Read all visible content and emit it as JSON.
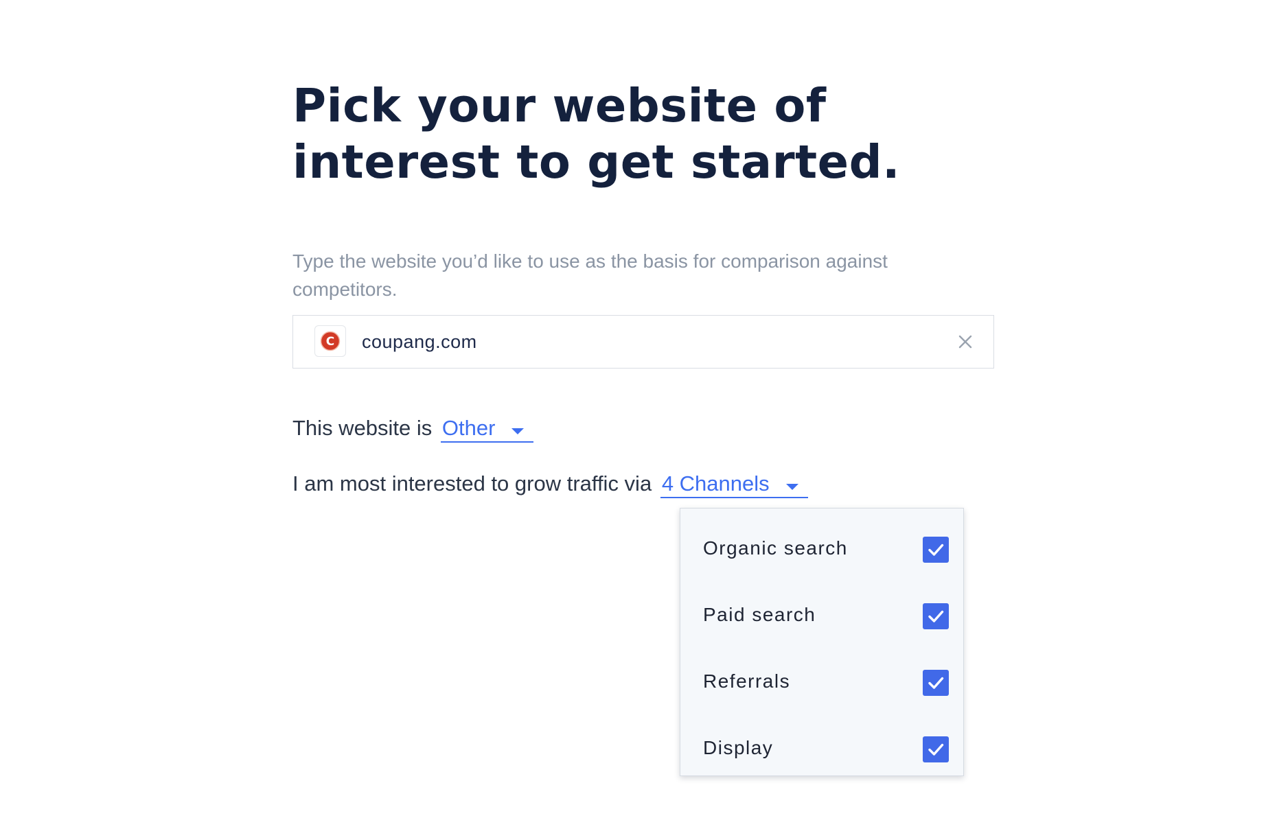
{
  "heading": {
    "line1": "Pick your website of",
    "line2": "interest to get started."
  },
  "subtitle": "Type the website you’d like to use as the basis for comparison against competitors.",
  "site_input": {
    "value": "coupang.com",
    "favicon_letter": "C",
    "favicon_icon": "coupang-favicon-icon",
    "clear_icon": "close-icon"
  },
  "website_type": {
    "prefix": "This website is",
    "selected": "Other"
  },
  "channels": {
    "prefix": "I am most interested to grow traffic via",
    "selected": "4 Channels",
    "options": [
      {
        "label": "Organic search",
        "checked": true
      },
      {
        "label": "Paid search",
        "checked": true
      },
      {
        "label": "Referrals",
        "checked": true
      },
      {
        "label": "Display",
        "checked": true
      }
    ]
  },
  "colors": {
    "heading": "#14213d",
    "accent": "#3d6ef0",
    "checkbox": "#4169e8",
    "favicon_red": "#d23a26"
  }
}
